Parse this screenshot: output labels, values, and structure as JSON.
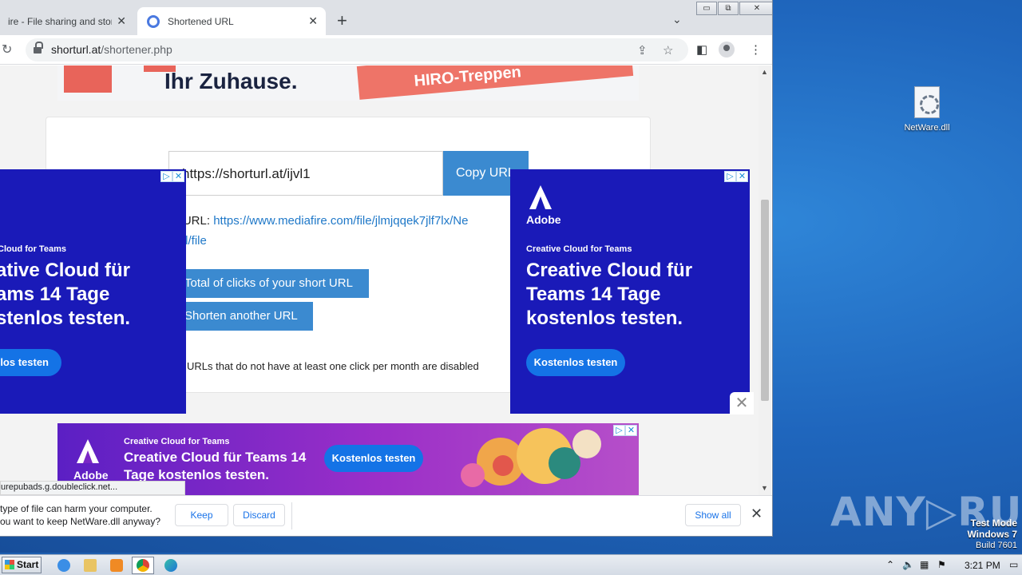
{
  "browser": {
    "tabs": [
      {
        "title": "ire - File sharing and storage m",
        "active": false
      },
      {
        "title": "Shortened URL",
        "active": true
      }
    ],
    "new_tab": "+",
    "tab_dropdown": "⌄",
    "window_controls": {
      "minimize": "▭",
      "maximize": "⧉",
      "close": "✕"
    },
    "address": {
      "host": "shorturl.at",
      "path": "/shortener.php"
    },
    "status_url": "urepubads.g.doubleclick.net..."
  },
  "top_ad": {
    "headline": "Ihr Zuhause.",
    "banner": "HIRO-Treppen"
  },
  "shortener": {
    "short_url": "https://shorturl.at/ijvl1",
    "copy_label": "Copy URL",
    "long_url_label": "ng URL: ",
    "long_url_value": "https://www.mediafire.com/file/jlmjqqek7jlf7lx/Ne",
    "long_url_cont": "e.dll/file",
    "clicks_label": "Total of clicks of your short URL",
    "another_label": "Shorten another URL",
    "note": "hort URLs that do not have at least one click per month are disabled"
  },
  "side_ads": {
    "brand": "Adobe",
    "subtitle": "Creative Cloud for Teams",
    "headline": "Creative Cloud für Teams 14 Tage kostenlos testen.",
    "left_subtitle": "Cloud for Teams",
    "left_headline": "ative Cloud für ams 14 Tage stenlos testen.",
    "cta": "Kostenlos testen",
    "left_cta": "nlos testen",
    "adchoice": "▷",
    "adclose": "✕"
  },
  "bottom_ad": {
    "brand": "Adobe",
    "subtitle": "Creative Cloud for Teams",
    "headline": "Creative Cloud für Teams 14 Tage kostenlos testen.",
    "cta": "Kostenlos testen"
  },
  "download_bar": {
    "line1": " type of file can harm your computer.",
    "line2": "ou want to keep NetWare.dll anyway?",
    "keep": "Keep",
    "discard": "Discard",
    "show_all": "Show all",
    "close": "✕"
  },
  "desktop": {
    "icon_label": "NetWare.dll",
    "watermark": "ANY▷RUN",
    "test_mode": "Test Mode",
    "os": "Windows 7",
    "build": "Build 7601"
  },
  "taskbar": {
    "start": "Start",
    "time": "3:21 PM"
  },
  "colors": {
    "accent_button": "#3b8ad0",
    "adobe_blue": "#1a1ab8",
    "cta_blue": "#1473e6",
    "link": "#1f78c8"
  }
}
